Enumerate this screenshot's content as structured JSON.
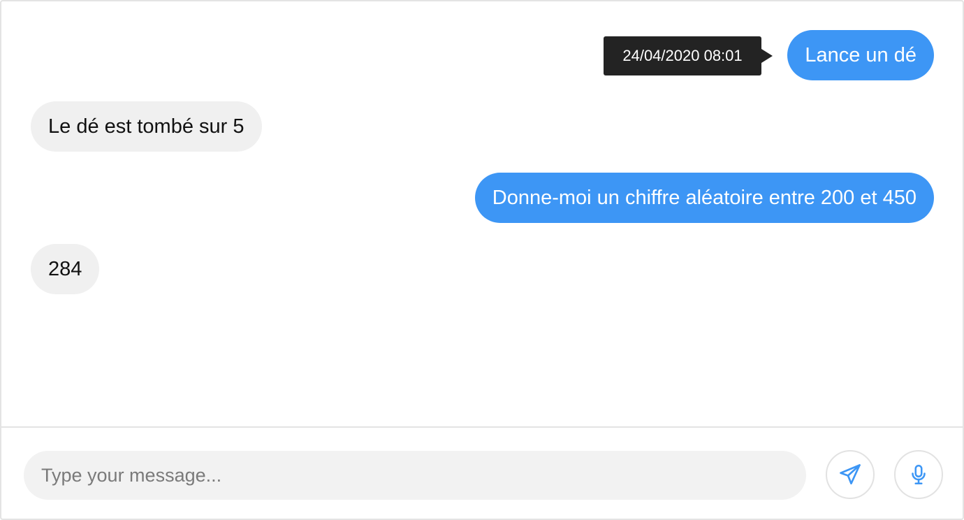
{
  "conversation": {
    "messages": [
      {
        "sender": "user",
        "text": "Lance un dé"
      },
      {
        "sender": "bot",
        "text": "Le dé est tombé sur 5"
      },
      {
        "sender": "user",
        "text": "Donne-moi un chiffre aléatoire entre 200 et 450"
      },
      {
        "sender": "bot",
        "text": "284"
      }
    ],
    "tooltip": {
      "timestamp": "24/04/2020 08:01"
    }
  },
  "composer": {
    "placeholder": "Type your message...",
    "value": "",
    "send_icon": "paper-plane-icon",
    "mic_icon": "microphone-icon"
  },
  "colors": {
    "user_bubble": "#3d96f5",
    "bot_bubble": "#f0f0f0",
    "tooltip_bg": "#232323",
    "icon_accent": "#3d96f5"
  }
}
